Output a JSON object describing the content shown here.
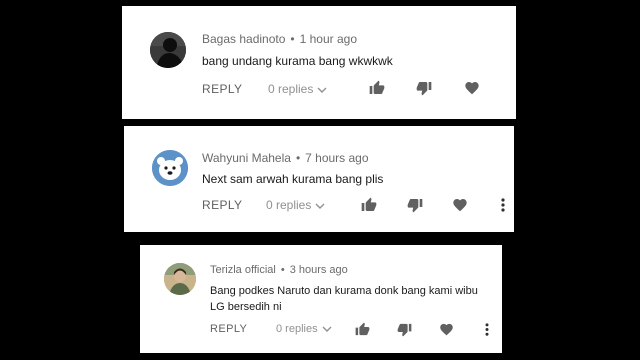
{
  "comments": [
    {
      "author": "Bagas hadinoto",
      "separator": "•",
      "time": "1 hour ago",
      "text": "bang undang kurama bang  wkwkwk",
      "reply_label": "REPLY",
      "replies_label": "0 replies",
      "avatar_icon": "silhouette-avatar",
      "has_more_menu": false
    },
    {
      "author": "Wahyuni Mahela",
      "separator": "•",
      "time": "7 hours ago",
      "text": "Next sam arwah kurama bang plis",
      "reply_label": "REPLY",
      "replies_label": "0 replies",
      "avatar_icon": "bear-avatar",
      "has_more_menu": true
    },
    {
      "author": "Terizla official",
      "separator": "•",
      "time": "3 hours ago",
      "text": "Bang podkes Naruto dan kurama donk bang kami wibu LG bersedih ni",
      "reply_label": "REPLY",
      "replies_label": "0 replies",
      "avatar_icon": "photo-avatar",
      "has_more_menu": true
    }
  ],
  "colors": {
    "background": "#000000",
    "card": "#ffffff",
    "icon": "#606060",
    "meta": "#6b6b6b",
    "avatar_blue": "#5d92c9"
  }
}
